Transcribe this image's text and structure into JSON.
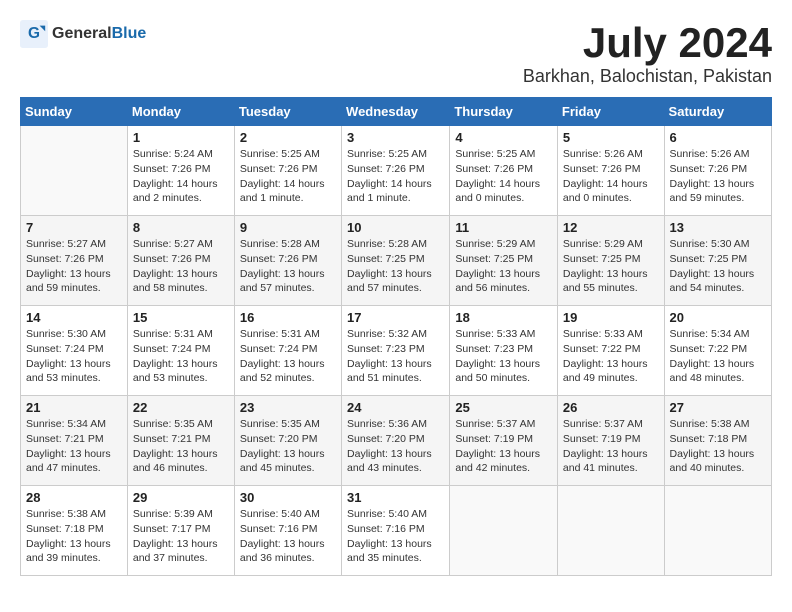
{
  "logo": {
    "general": "General",
    "blue": "Blue"
  },
  "title": "July 2024",
  "subtitle": "Barkhan, Balochistan, Pakistan",
  "days_header": [
    "Sunday",
    "Monday",
    "Tuesday",
    "Wednesday",
    "Thursday",
    "Friday",
    "Saturday"
  ],
  "weeks": [
    [
      {
        "num": "",
        "info": ""
      },
      {
        "num": "1",
        "info": "Sunrise: 5:24 AM\nSunset: 7:26 PM\nDaylight: 14 hours\nand 2 minutes."
      },
      {
        "num": "2",
        "info": "Sunrise: 5:25 AM\nSunset: 7:26 PM\nDaylight: 14 hours\nand 1 minute."
      },
      {
        "num": "3",
        "info": "Sunrise: 5:25 AM\nSunset: 7:26 PM\nDaylight: 14 hours\nand 1 minute."
      },
      {
        "num": "4",
        "info": "Sunrise: 5:25 AM\nSunset: 7:26 PM\nDaylight: 14 hours\nand 0 minutes."
      },
      {
        "num": "5",
        "info": "Sunrise: 5:26 AM\nSunset: 7:26 PM\nDaylight: 14 hours\nand 0 minutes."
      },
      {
        "num": "6",
        "info": "Sunrise: 5:26 AM\nSunset: 7:26 PM\nDaylight: 13 hours\nand 59 minutes."
      }
    ],
    [
      {
        "num": "7",
        "info": "Sunrise: 5:27 AM\nSunset: 7:26 PM\nDaylight: 13 hours\nand 59 minutes."
      },
      {
        "num": "8",
        "info": "Sunrise: 5:27 AM\nSunset: 7:26 PM\nDaylight: 13 hours\nand 58 minutes."
      },
      {
        "num": "9",
        "info": "Sunrise: 5:28 AM\nSunset: 7:26 PM\nDaylight: 13 hours\nand 57 minutes."
      },
      {
        "num": "10",
        "info": "Sunrise: 5:28 AM\nSunset: 7:25 PM\nDaylight: 13 hours\nand 57 minutes."
      },
      {
        "num": "11",
        "info": "Sunrise: 5:29 AM\nSunset: 7:25 PM\nDaylight: 13 hours\nand 56 minutes."
      },
      {
        "num": "12",
        "info": "Sunrise: 5:29 AM\nSunset: 7:25 PM\nDaylight: 13 hours\nand 55 minutes."
      },
      {
        "num": "13",
        "info": "Sunrise: 5:30 AM\nSunset: 7:25 PM\nDaylight: 13 hours\nand 54 minutes."
      }
    ],
    [
      {
        "num": "14",
        "info": "Sunrise: 5:30 AM\nSunset: 7:24 PM\nDaylight: 13 hours\nand 53 minutes."
      },
      {
        "num": "15",
        "info": "Sunrise: 5:31 AM\nSunset: 7:24 PM\nDaylight: 13 hours\nand 53 minutes."
      },
      {
        "num": "16",
        "info": "Sunrise: 5:31 AM\nSunset: 7:24 PM\nDaylight: 13 hours\nand 52 minutes."
      },
      {
        "num": "17",
        "info": "Sunrise: 5:32 AM\nSunset: 7:23 PM\nDaylight: 13 hours\nand 51 minutes."
      },
      {
        "num": "18",
        "info": "Sunrise: 5:33 AM\nSunset: 7:23 PM\nDaylight: 13 hours\nand 50 minutes."
      },
      {
        "num": "19",
        "info": "Sunrise: 5:33 AM\nSunset: 7:22 PM\nDaylight: 13 hours\nand 49 minutes."
      },
      {
        "num": "20",
        "info": "Sunrise: 5:34 AM\nSunset: 7:22 PM\nDaylight: 13 hours\nand 48 minutes."
      }
    ],
    [
      {
        "num": "21",
        "info": "Sunrise: 5:34 AM\nSunset: 7:21 PM\nDaylight: 13 hours\nand 47 minutes."
      },
      {
        "num": "22",
        "info": "Sunrise: 5:35 AM\nSunset: 7:21 PM\nDaylight: 13 hours\nand 46 minutes."
      },
      {
        "num": "23",
        "info": "Sunrise: 5:35 AM\nSunset: 7:20 PM\nDaylight: 13 hours\nand 45 minutes."
      },
      {
        "num": "24",
        "info": "Sunrise: 5:36 AM\nSunset: 7:20 PM\nDaylight: 13 hours\nand 43 minutes."
      },
      {
        "num": "25",
        "info": "Sunrise: 5:37 AM\nSunset: 7:19 PM\nDaylight: 13 hours\nand 42 minutes."
      },
      {
        "num": "26",
        "info": "Sunrise: 5:37 AM\nSunset: 7:19 PM\nDaylight: 13 hours\nand 41 minutes."
      },
      {
        "num": "27",
        "info": "Sunrise: 5:38 AM\nSunset: 7:18 PM\nDaylight: 13 hours\nand 40 minutes."
      }
    ],
    [
      {
        "num": "28",
        "info": "Sunrise: 5:38 AM\nSunset: 7:18 PM\nDaylight: 13 hours\nand 39 minutes."
      },
      {
        "num": "29",
        "info": "Sunrise: 5:39 AM\nSunset: 7:17 PM\nDaylight: 13 hours\nand 37 minutes."
      },
      {
        "num": "30",
        "info": "Sunrise: 5:40 AM\nSunset: 7:16 PM\nDaylight: 13 hours\nand 36 minutes."
      },
      {
        "num": "31",
        "info": "Sunrise: 5:40 AM\nSunset: 7:16 PM\nDaylight: 13 hours\nand 35 minutes."
      },
      {
        "num": "",
        "info": ""
      },
      {
        "num": "",
        "info": ""
      },
      {
        "num": "",
        "info": ""
      }
    ]
  ]
}
